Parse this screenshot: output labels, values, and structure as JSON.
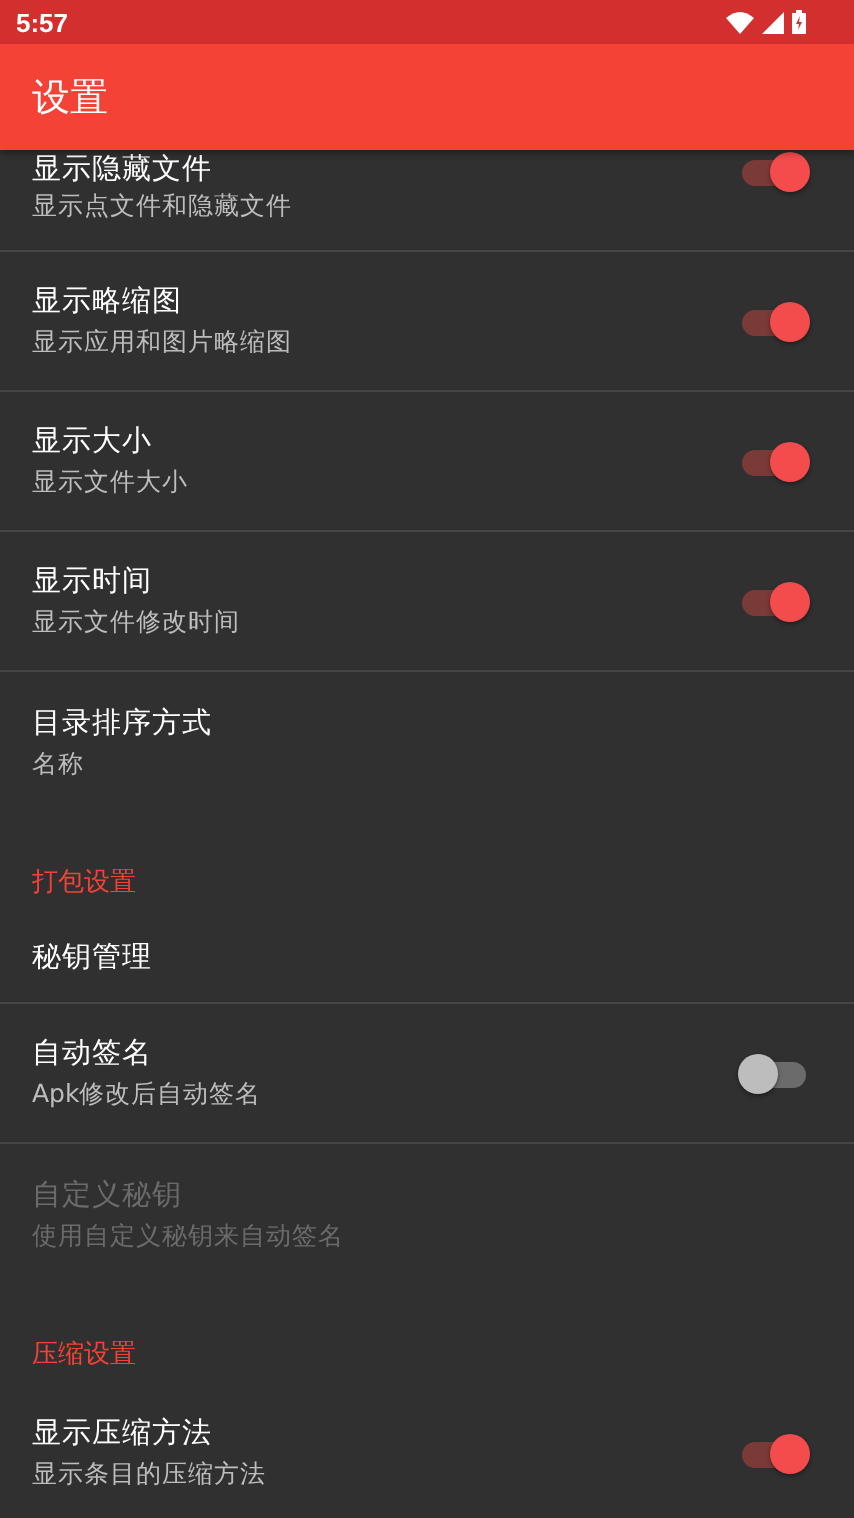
{
  "status_bar": {
    "time": "5:57"
  },
  "app_bar": {
    "title": "设置"
  },
  "items": [
    {
      "kind": "switch",
      "title": "显示隐藏文件",
      "summary": "显示点文件和隐藏文件",
      "on": true,
      "disabled": false
    },
    {
      "kind": "switch",
      "title": "显示略缩图",
      "summary": "显示应用和图片略缩图",
      "on": true,
      "disabled": false
    },
    {
      "kind": "switch",
      "title": "显示大小",
      "summary": "显示文件大小",
      "on": true,
      "disabled": false
    },
    {
      "kind": "switch",
      "title": "显示时间",
      "summary": "显示文件修改时间",
      "on": true,
      "disabled": false
    },
    {
      "kind": "plain",
      "title": "目录排序方式",
      "summary": "名称",
      "disabled": false
    },
    {
      "kind": "category",
      "title": "打包设置"
    },
    {
      "kind": "plain",
      "title": "秘钥管理",
      "disabled": false
    },
    {
      "kind": "switch",
      "title": "自动签名",
      "summary": "Apk修改后自动签名",
      "on": false,
      "disabled": false
    },
    {
      "kind": "plain",
      "title": "自定义秘钥",
      "summary": "使用自定义秘钥来自动签名",
      "disabled": true
    },
    {
      "kind": "category",
      "title": "压缩设置"
    },
    {
      "kind": "switch",
      "title": "显示压缩方法",
      "summary": "显示条目的压缩方法",
      "on": true,
      "disabled": false
    }
  ]
}
